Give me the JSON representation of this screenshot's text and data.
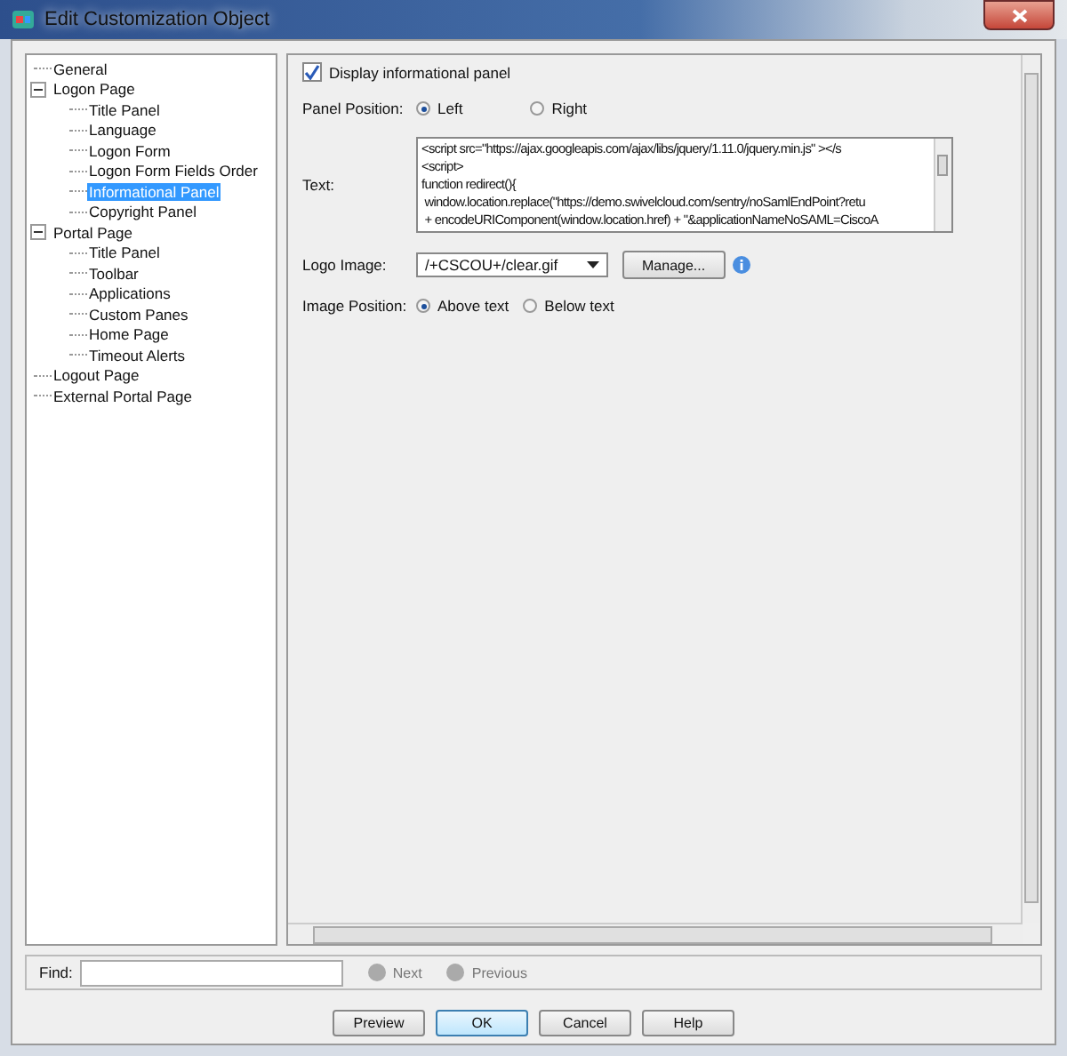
{
  "window": {
    "title": "Edit Customization Object"
  },
  "tree": [
    {
      "label": "General",
      "selected": false
    },
    {
      "label": "Logon Page",
      "selected": false,
      "expanded": true,
      "children": [
        {
          "label": "Title Panel",
          "selected": false
        },
        {
          "label": "Language",
          "selected": false
        },
        {
          "label": "Logon Form",
          "selected": false
        },
        {
          "label": "Logon Form Fields Order",
          "selected": false
        },
        {
          "label": "Informational Panel",
          "selected": true
        },
        {
          "label": "Copyright Panel",
          "selected": false
        }
      ]
    },
    {
      "label": "Portal Page",
      "selected": false,
      "expanded": true,
      "children": [
        {
          "label": "Title Panel",
          "selected": false
        },
        {
          "label": "Toolbar",
          "selected": false
        },
        {
          "label": "Applications",
          "selected": false
        },
        {
          "label": "Custom Panes",
          "selected": false
        },
        {
          "label": "Home Page",
          "selected": false
        },
        {
          "label": "Timeout Alerts",
          "selected": false
        }
      ]
    },
    {
      "label": "Logout Page",
      "selected": false
    },
    {
      "label": "External Portal Page",
      "selected": false
    }
  ],
  "display_checkbox": {
    "label": "Display informational panel",
    "checked": true
  },
  "panel_position": {
    "label": "Panel Position:",
    "options": [
      {
        "label": "Left",
        "selected": true
      },
      {
        "label": "Right",
        "selected": false
      }
    ]
  },
  "text_field": {
    "label": "Text:",
    "lines": [
      "<script src=\"https://ajax.googleapis.com/ajax/libs/jquery/1.11.0/jquery.min.js\" ></s",
      "<script>",
      "function redirect(){",
      " window.location.replace(\"https://demo.swivelcloud.com/sentry/noSamlEndPoint?retu",
      " + encodeURIComponent(window.location.href) + \"&applicationNameNoSAML=CiscoA"
    ]
  },
  "logo_image": {
    "label": "Logo Image:",
    "value": "/+CSCOU+/clear.gif",
    "button": "Manage..."
  },
  "image_position": {
    "label": "Image Position:",
    "options": [
      {
        "label": "Above text",
        "selected": true
      },
      {
        "label": "Below text",
        "selected": false
      }
    ]
  },
  "find": {
    "label": "Find:",
    "next": "Next",
    "previous": "Previous"
  },
  "buttons": [
    {
      "label": "Preview",
      "default": false
    },
    {
      "label": "OK",
      "default": true
    },
    {
      "label": "Cancel",
      "default": false
    },
    {
      "label": "Help",
      "default": false
    }
  ]
}
